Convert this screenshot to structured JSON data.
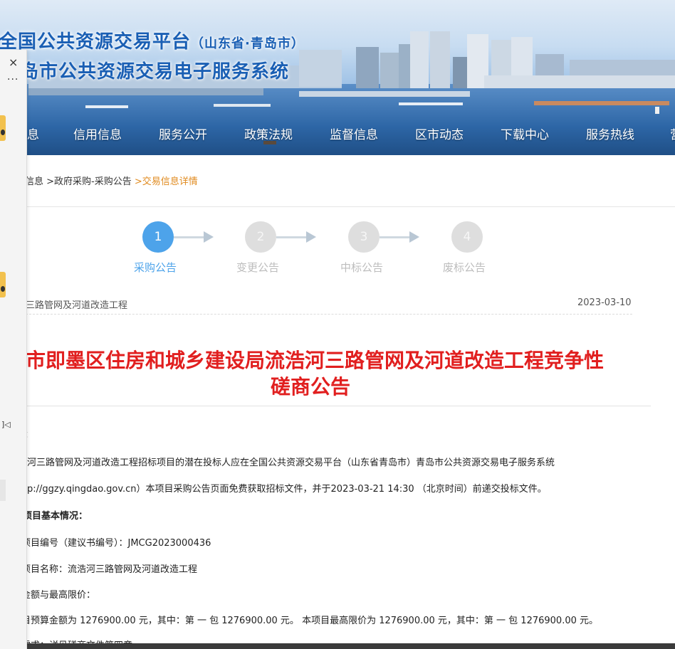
{
  "banner": {
    "title_main": "全国公共资源交易平台",
    "title_region": "（山东省·青岛市）",
    "title_sub": "岛市公共资源交易电子服务系统"
  },
  "nav": {
    "items": [
      "息",
      "信用信息",
      "服务公开",
      "政策法规",
      "监督信息",
      "区市动态",
      "下载中心",
      "服务热线",
      "营"
    ]
  },
  "side_panel": {
    "close": "×",
    "more": "···",
    "glyph": "]◁"
  },
  "breadcrumb": {
    "items": [
      "易信息",
      ">政府采购-采购公告",
      ">交易信息详情"
    ]
  },
  "steps": [
    {
      "number": "1",
      "label": "采购公告",
      "active": true
    },
    {
      "number": "2",
      "label": "变更公告",
      "active": false
    },
    {
      "number": "3",
      "label": "中标公告",
      "active": false
    },
    {
      "number": "4",
      "label": "废标公告",
      "active": false
    }
  ],
  "notice": {
    "project_short": "三路管网及河道改造工程",
    "date": "2023-03-10",
    "title_line1": "市即墨区住房和城乡建设局流浩河三路管网及河道改造工程竞争性",
    "title_line2": "磋商公告",
    "para_colon": "：",
    "para1_line1": "河三路管网及河道改造工程招标项目的潜在投标人应在全国公共资源交易平台（山东省青岛市）青岛市公共资源交易电子服务系统",
    "para1_line2": "p://ggzy.qingdao.gov.cn）本项目采购公告页面免费获取招标文件，并于2023-03-21 14:30 （北京时间）前递交投标文件。",
    "section_title": "采购项目基本情况：",
    "project_no": "采购项目编号（建议书编号）：JMCG2023000436",
    "project_name": "采购项目名称：流浩河三路管网及河道改造工程",
    "budget_label": "预算金额与最高限价：",
    "budget_text": "本项目预算金额为 1276900.00 元，其中：第 一 包 1276900.00 元。 本项目最高限价为 1276900.00 元，其中：第 一 包 1276900.00 元。",
    "requirement_partial": "采购需求：详见磋商文件第四章"
  }
}
